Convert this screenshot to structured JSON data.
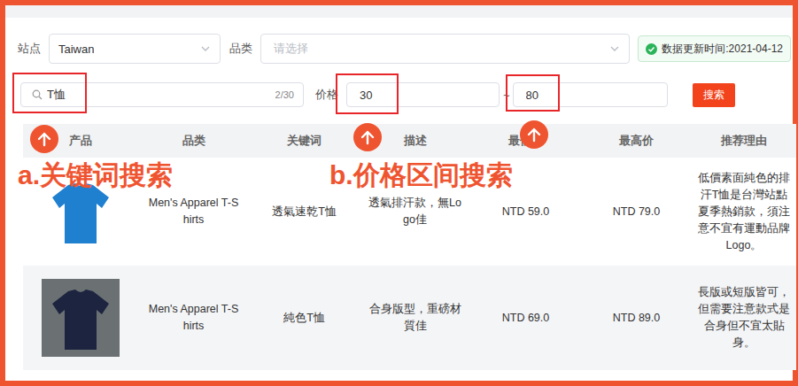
{
  "filters": {
    "site": {
      "label": "站点",
      "value": "Taiwan"
    },
    "category": {
      "label": "品类",
      "placeholder": "请选择"
    },
    "update_badge": "数据更新时间:2021-04-12"
  },
  "search": {
    "value": "T恤",
    "counter": "2/30"
  },
  "price": {
    "label": "价格",
    "min": "30",
    "separator": "~",
    "max": "80"
  },
  "search_button": "搜索",
  "annotations": [
    {
      "label": "a.关键词搜索"
    },
    {
      "label": "b.价格区间搜索"
    }
  ],
  "table": {
    "columns": [
      "产品",
      "品类",
      "关键词",
      "描述",
      "最低价",
      "最高价",
      "推荐理由"
    ],
    "rows": [
      {
        "category": "Men's Apparel T-Shirts",
        "keyword": "透氣速乾T恤",
        "description": "透氣排汗款，無Logo佳",
        "min_price": "NTD 59.0",
        "max_price": "NTD 79.0",
        "reason": "低價素面純色的排汗T恤是台灣站點夏季熱銷款，須注意不宜有運動品牌Logo。",
        "color": "#1f80d0"
      },
      {
        "category": "Men's Apparel T-Shirts",
        "keyword": "純色T恤",
        "description": "合身版型，重磅材質佳",
        "min_price": "NTD 69.0",
        "max_price": "NTD 89.0",
        "reason": "長版或短版皆可，但需要注意款式是合身但不宜太貼身。",
        "color": "#1c2440"
      }
    ]
  }
}
